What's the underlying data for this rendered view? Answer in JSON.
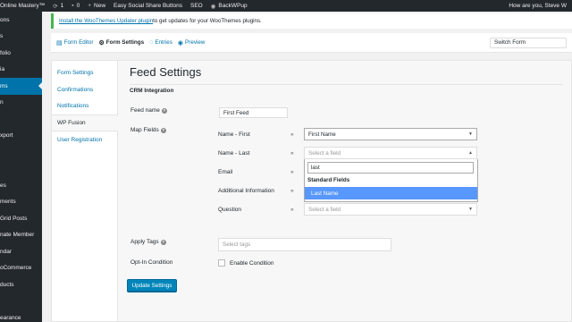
{
  "adminbar": {
    "site_name": "Online Mastery™",
    "updates_count": "1",
    "comments_count": "0",
    "new_label": "New",
    "plugin1": "Easy Social Share Buttons",
    "plugin2": "SEO",
    "plugin3": "BackWPup",
    "greeting": "How are you, Steve W"
  },
  "sidebar": {
    "items": [
      {
        "label": "ons"
      },
      {
        "label": "s"
      },
      {
        "label": "folio"
      },
      {
        "label": "ia"
      },
      {
        "label": "ms"
      },
      {
        "label": "n"
      },
      {
        "label": ""
      },
      {
        "label": "xport"
      },
      {
        "label": ""
      },
      {
        "label": ""
      },
      {
        "label": "es"
      },
      {
        "label": "ments"
      },
      {
        "label": "Grid Posts"
      },
      {
        "label": "nate Member"
      },
      {
        "label": "ndar"
      },
      {
        "label": "oCommerce"
      },
      {
        "label": "ducts"
      },
      {
        "label": ""
      },
      {
        "label": "earance"
      }
    ]
  },
  "notice": {
    "link_text": "Install the WooThemes Updater plugin",
    "rest_text": " to get updates for your WooThemes plugins."
  },
  "toolbar": {
    "form_editor": "Form Editor",
    "form_settings": "Form Settings",
    "entries": "Entries",
    "preview": "Preview",
    "switch_form": "Switch Form"
  },
  "tabs": {
    "form_settings": "Form Settings",
    "confirmations": "Confirmations",
    "notifications": "Notifications",
    "wp_fusion": "WP Fusion",
    "user_registration": "User Registration"
  },
  "feed": {
    "title": "Feed Settings",
    "section": "CRM Integration",
    "feed_name_label": "Feed name",
    "feed_name_value": "First Feed",
    "map_fields_label": "Map Fields",
    "rows": [
      {
        "label": "Name - First",
        "value": "First Name"
      },
      {
        "label": "Name - Last",
        "value": "Select a field"
      },
      {
        "label": "Email",
        "value": ""
      },
      {
        "label": "Additional Information",
        "value": ""
      },
      {
        "label": "Question",
        "value": "Select a field"
      }
    ],
    "arrow_glyph": "»",
    "dropdown": {
      "search_value": "last",
      "group_label": "Standard Fields",
      "highlighted_option": "Last Name"
    },
    "apply_tags_label": "Apply Tags",
    "apply_tags_placeholder": "Select tags",
    "optin_label": "Opt-In Condition",
    "enable_condition_label": "Enable Condition",
    "update_button": "Update Settings"
  }
}
